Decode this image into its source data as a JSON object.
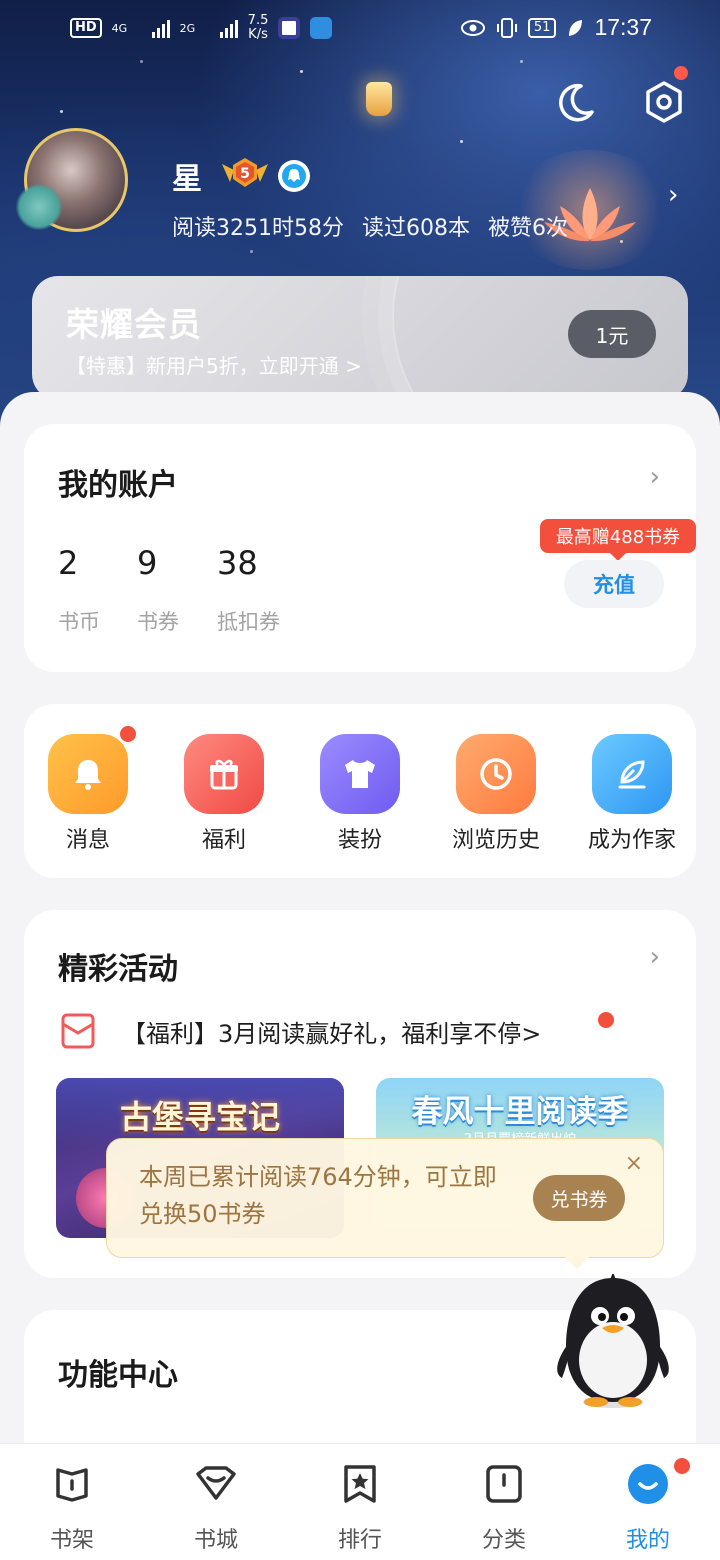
{
  "status_bar": {
    "hd": "HD",
    "net1": "4G",
    "net2": "2G",
    "speed_value": "7.5",
    "speed_unit": "K/s",
    "battery": "51",
    "time": "17:37"
  },
  "profile": {
    "name": "星",
    "level": "5",
    "stats": [
      "阅读3251时58分",
      "读过608本",
      "被赞6次"
    ],
    "arrow": "›"
  },
  "vip": {
    "title": "荣耀会员",
    "subtitle": "【特惠】新用户5折，立即开通 >",
    "button": "1元"
  },
  "account": {
    "title": "我的账户",
    "chevron": "›",
    "items": [
      {
        "value": "2",
        "label": "书币"
      },
      {
        "value": "9",
        "label": "书券"
      },
      {
        "value": "38",
        "label": "抵扣券"
      }
    ],
    "promo": "最高赠488书券",
    "recharge": "充值"
  },
  "shortcuts": [
    {
      "label": "消息",
      "icon": "bell-icon"
    },
    {
      "label": "福利",
      "icon": "gift-icon"
    },
    {
      "label": "装扮",
      "icon": "shirt-icon"
    },
    {
      "label": "浏览历史",
      "icon": "clock-icon"
    },
    {
      "label": "成为作家",
      "icon": "pen-icon"
    }
  ],
  "activities": {
    "title": "精彩活动",
    "chevron": "›",
    "headline": "【福利】3月阅读赢好礼，福利享不停>",
    "banner1": "古堡寻宝记",
    "banner2": "春风十里阅读季",
    "banner2_sub": "2月月票榜新鲜出炉"
  },
  "toast": {
    "text": "本周已累计阅读764分钟，可立即兑换50书券",
    "button": "兑书券",
    "close": "×"
  },
  "features": {
    "title": "功能中心"
  },
  "tabs": [
    {
      "label": "书架",
      "icon": "bookshelf-icon"
    },
    {
      "label": "书城",
      "icon": "bookstore-icon"
    },
    {
      "label": "排行",
      "icon": "ranking-icon"
    },
    {
      "label": "分类",
      "icon": "category-icon"
    },
    {
      "label": "我的",
      "icon": "profile-icon"
    }
  ],
  "colors": {
    "accent": "#1f8fe8",
    "badge_red": "#f2503c",
    "toast_text": "#9e7440"
  }
}
